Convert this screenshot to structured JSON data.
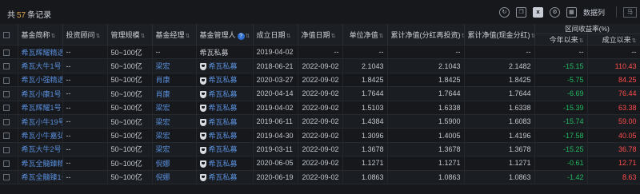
{
  "header": {
    "count_prefix": "共",
    "count_value": "57",
    "count_suffix": "条记录",
    "toolbar": {
      "data_column_label": "数据列",
      "shortcut_label": "马"
    }
  },
  "table": {
    "group_header": "区间收益率(%)",
    "columns": [
      {
        "label": "基金简称"
      },
      {
        "label": "投资顾问"
      },
      {
        "label": "管理规模"
      },
      {
        "label": "基金经理"
      },
      {
        "label": "基金管理人"
      },
      {
        "label": "成立日期"
      },
      {
        "label": "净值日期"
      },
      {
        "label": "单位净值"
      },
      {
        "label": "累计净值(分红再投资)"
      },
      {
        "label": "累计净值(现金分红)"
      }
    ],
    "sub_columns": [
      {
        "label": "今年以来"
      },
      {
        "label": "成立以来"
      }
    ],
    "rows": [
      {
        "name": "希瓦辉耀精选",
        "advisor": "--",
        "scale": "50~100亿",
        "manager": "--",
        "company": "希瓦私募",
        "company_icon": false,
        "found": "2019-04-02",
        "nav_date": "--",
        "nav": "--",
        "acc_reinvest": "--",
        "acc_cash": "--",
        "ytd": "--",
        "ytd_dir": "flat",
        "since": "--",
        "since_dir": "flat"
      },
      {
        "name": "希瓦大牛1号",
        "advisor": "--",
        "scale": "50~100亿",
        "manager": "梁宏",
        "company": "希瓦私募",
        "company_icon": true,
        "found": "2018-06-21",
        "nav_date": "2022-09-02",
        "nav": "2.1043",
        "acc_reinvest": "2.1043",
        "acc_cash": "2.1482",
        "ytd": "-15.15",
        "ytd_dir": "down",
        "since": "110.43",
        "since_dir": "up"
      },
      {
        "name": "希瓦小强精选",
        "advisor": "--",
        "scale": "50~100亿",
        "manager": "肖康",
        "company": "希瓦私募",
        "company_icon": true,
        "found": "2020-03-27",
        "nav_date": "2022-09-02",
        "nav": "1.8425",
        "acc_reinvest": "1.8425",
        "acc_cash": "1.8425",
        "ytd": "-5.75",
        "ytd_dir": "down",
        "since": "84.25",
        "since_dir": "up"
      },
      {
        "name": "希瓦小康1号",
        "advisor": "--",
        "scale": "50~100亿",
        "manager": "肖康",
        "company": "希瓦私募",
        "company_icon": true,
        "found": "2020-04-14",
        "nav_date": "2022-09-02",
        "nav": "1.7644",
        "acc_reinvest": "1.7644",
        "acc_cash": "1.7644",
        "ytd": "-6.69",
        "ytd_dir": "down",
        "since": "76.44",
        "since_dir": "up"
      },
      {
        "name": "希瓦辉耀1号",
        "advisor": "--",
        "scale": "50~100亿",
        "manager": "梁宏",
        "company": "希瓦私募",
        "company_icon": true,
        "found": "2019-04-02",
        "nav_date": "2022-09-02",
        "nav": "1.5103",
        "acc_reinvest": "1.6338",
        "acc_cash": "1.6338",
        "ytd": "-15.39",
        "ytd_dir": "down",
        "since": "63.38",
        "since_dir": "up"
      },
      {
        "name": "希瓦小牛19号",
        "advisor": "--",
        "scale": "50~100亿",
        "manager": "梁宏",
        "company": "希瓦私募",
        "company_icon": true,
        "found": "2019-06-11",
        "nav_date": "2022-09-02",
        "nav": "1.4384",
        "acc_reinvest": "1.5900",
        "acc_cash": "1.6083",
        "ytd": "-15.74",
        "ytd_dir": "down",
        "since": "59.00",
        "since_dir": "up"
      },
      {
        "name": "希瓦小牛嘉弘",
        "advisor": "--",
        "scale": "50~100亿",
        "manager": "梁宏",
        "company": "希瓦私募",
        "company_icon": true,
        "found": "2019-04-30",
        "nav_date": "2022-09-02",
        "nav": "1.3096",
        "acc_reinvest": "1.4005",
        "acc_cash": "1.4196",
        "ytd": "-17.58",
        "ytd_dir": "down",
        "since": "40.05",
        "since_dir": "up"
      },
      {
        "name": "希瓦大牛2号",
        "advisor": "--",
        "scale": "50~100亿",
        "manager": "梁宏",
        "company": "希瓦私募",
        "company_icon": true,
        "found": "2019-03-11",
        "nav_date": "2022-09-02",
        "nav": "1.3678",
        "acc_reinvest": "1.3678",
        "acc_cash": "1.3678",
        "ytd": "-15.25",
        "ytd_dir": "down",
        "since": "36.78",
        "since_dir": "up"
      },
      {
        "name": "希瓦全髓臻精选",
        "advisor": "--",
        "scale": "50~100亿",
        "manager": "倪娜",
        "company": "希瓦私募",
        "company_icon": true,
        "found": "2020-06-05",
        "nav_date": "2022-09-02",
        "nav": "1.1271",
        "acc_reinvest": "1.1271",
        "acc_cash": "1.1271",
        "ytd": "-0.61",
        "ytd_dir": "down",
        "since": "12.71",
        "since_dir": "up"
      },
      {
        "name": "希瓦全髓臻1号",
        "advisor": "--",
        "scale": "50~100亿",
        "manager": "倪娜",
        "company": "希瓦私募",
        "company_icon": true,
        "found": "2020-06-19",
        "nav_date": "2022-09-02",
        "nav": "1.0863",
        "acc_reinvest": "1.0863",
        "acc_cash": "1.0863",
        "ytd": "-1.42",
        "ytd_dir": "down",
        "since": "8.63",
        "since_dir": "up"
      }
    ]
  },
  "colors": {
    "background": "#16181c",
    "link": "#5a8fdc",
    "up": "#ff4d4d",
    "down": "#22b860",
    "count_highlight": "#e0a34a"
  }
}
